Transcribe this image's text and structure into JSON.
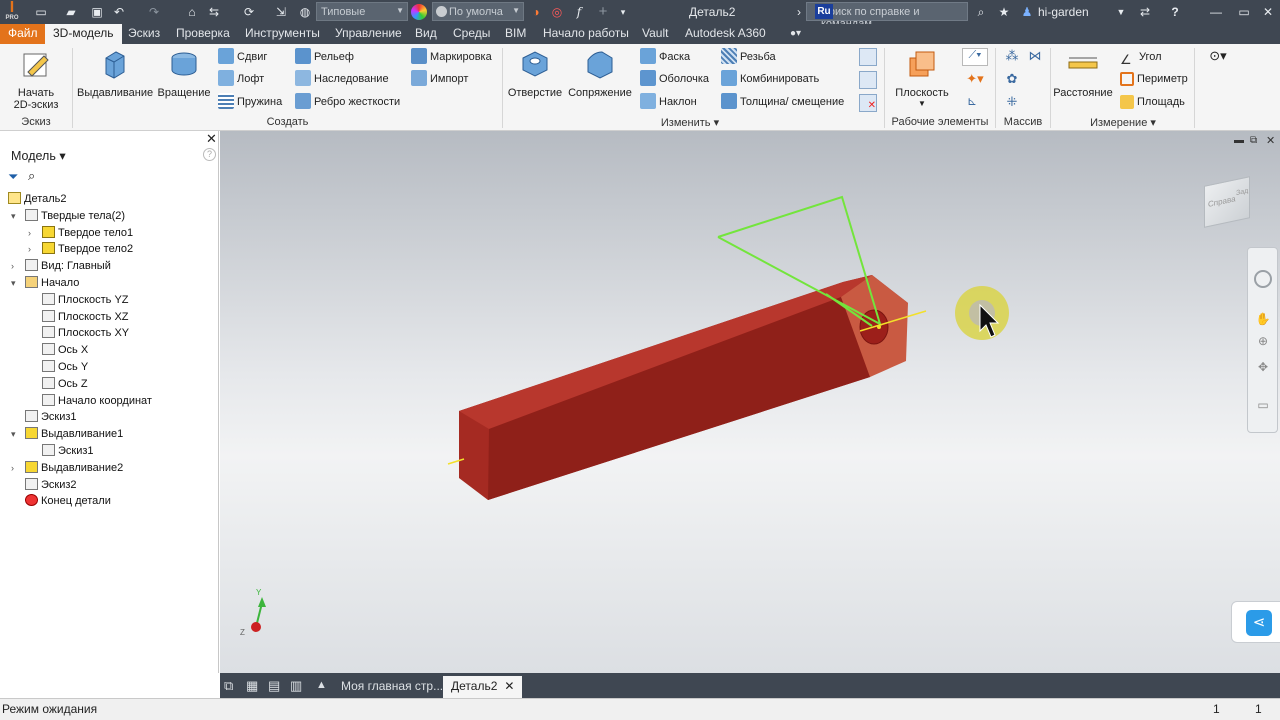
{
  "window": {
    "title": "Деталь2",
    "user": "hi-garden"
  },
  "qat": {
    "appearance_select": "Типовые",
    "material_select": "По умолча",
    "search_placeholder": "Поиск по справке и командам...",
    "lang_badge": "Ru",
    "plus": "+",
    "fx": "f",
    "pro": "PRO"
  },
  "tabs": [
    {
      "label": "Файл"
    },
    {
      "label": "3D-модель"
    },
    {
      "label": "Эскиз"
    },
    {
      "label": "Проверка"
    },
    {
      "label": "Инструменты"
    },
    {
      "label": "Управление"
    },
    {
      "label": "Вид"
    },
    {
      "label": "Среды"
    },
    {
      "label": "BIM"
    },
    {
      "label": "Начало работы"
    },
    {
      "label": "Vault"
    },
    {
      "label": "Autodesk A360"
    }
  ],
  "ribbon": {
    "sketch": {
      "start": "Начать",
      "start2": "2D-эскиз",
      "group": "Эскиз"
    },
    "create": {
      "extrude": "Выдавливание",
      "revolve": "Вращение",
      "sweep": "Сдвиг",
      "loft": "Лофт",
      "coil": "Пружина",
      "emboss": "Рельеф",
      "derive": "Наследование",
      "rib": "Ребро жесткости",
      "mark": "Маркировка",
      "import": "Импорт",
      "group": "Создать"
    },
    "modify": {
      "hole": "Отверстие",
      "fillet": "Сопряжение",
      "chamfer": "Фаска",
      "shell": "Оболочка",
      "draft": "Наклон",
      "thread": "Резьба",
      "combine": "Комбинировать",
      "thicken": "Толщина/ смещение",
      "group": "Изменить"
    },
    "work": {
      "plane": "Плоскость",
      "group": "Рабочие элементы"
    },
    "pattern": {
      "group": "Массив"
    },
    "measure": {
      "distance": "Расстояние",
      "angle": "Угол",
      "perimeter": "Периметр",
      "area": "Площадь",
      "group": "Измерение"
    }
  },
  "browser": {
    "title": "Модель",
    "nodes": [
      {
        "label": "Деталь2",
        "indent": 0,
        "expander": ""
      },
      {
        "label": "Твердые тела(2)",
        "indent": 1,
        "expander": "v"
      },
      {
        "label": "Твердое тело1",
        "indent": 2,
        "expander": ">"
      },
      {
        "label": "Твердое тело2",
        "indent": 2,
        "expander": ">"
      },
      {
        "label": "Вид: Главный",
        "indent": 1,
        "expander": ">"
      },
      {
        "label": "Начало",
        "indent": 1,
        "expander": "v"
      },
      {
        "label": "Плоскость YZ",
        "indent": 2,
        "expander": ""
      },
      {
        "label": "Плоскость XZ",
        "indent": 2,
        "expander": ""
      },
      {
        "label": "Плоскость XY",
        "indent": 2,
        "expander": ""
      },
      {
        "label": "Ось X",
        "indent": 2,
        "expander": ""
      },
      {
        "label": "Ось Y",
        "indent": 2,
        "expander": ""
      },
      {
        "label": "Ось Z",
        "indent": 2,
        "expander": ""
      },
      {
        "label": "Начало координат",
        "indent": 2,
        "expander": ""
      },
      {
        "label": "Эскиз1",
        "indent": 1,
        "expander": ""
      },
      {
        "label": "Выдавливание1",
        "indent": 1,
        "expander": "v"
      },
      {
        "label": "Эскиз1",
        "indent": 2,
        "expander": ""
      },
      {
        "label": "Выдавливание2",
        "indent": 1,
        "expander": ">"
      },
      {
        "label": "Эскиз2",
        "indent": 1,
        "expander": ""
      },
      {
        "label": "Конец детали",
        "indent": 1,
        "expander": ""
      }
    ]
  },
  "viewport": {
    "viewcube_front": "Справа",
    "viewcube_side": "Зад",
    "axis_y": "Y",
    "axis_z": "Z"
  },
  "doctabs": [
    {
      "label": "Моя главная стр..."
    },
    {
      "label": "Деталь2"
    }
  ],
  "status": {
    "text": "Режим ожидания",
    "count1": "1",
    "count2": "1"
  },
  "colors": {
    "accent": "#e3731b",
    "dark_bar": "#3f4752",
    "body": "#a82c25"
  }
}
